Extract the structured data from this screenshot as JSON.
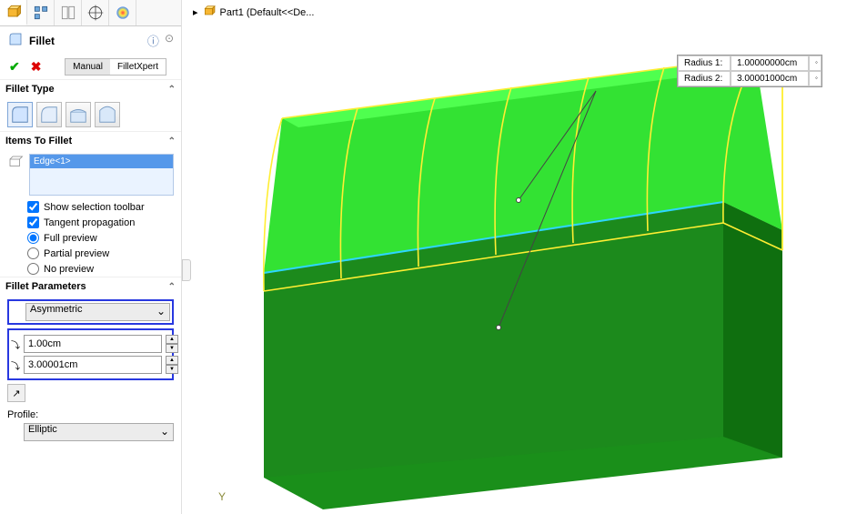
{
  "tree": {
    "part_label": "Part1  (Default<<De..."
  },
  "feature": {
    "title": "Fillet",
    "tabs": {
      "manual": "Manual",
      "xpert": "FilletXpert"
    }
  },
  "sections": {
    "fillet_type": "Fillet Type",
    "items": "Items To Fillet",
    "params": "Fillet Parameters"
  },
  "items": {
    "selection": "Edge<1>",
    "show_toolbar": "Show selection toolbar",
    "tangent": "Tangent propagation",
    "full_preview": "Full preview",
    "partial_preview": "Partial preview",
    "no_preview": "No preview"
  },
  "params": {
    "symmetry": "Asymmetric",
    "radius1": "1.00cm",
    "radius2": "3.00001cm"
  },
  "profile": {
    "label": "Profile:",
    "value": "Elliptic"
  },
  "callout": {
    "r1_label": "Radius 1:",
    "r1_val": "1.00000000cm",
    "r2_label": "Radius 2:",
    "r2_val": "3.00001000cm"
  },
  "axis": {
    "y": "Y"
  }
}
